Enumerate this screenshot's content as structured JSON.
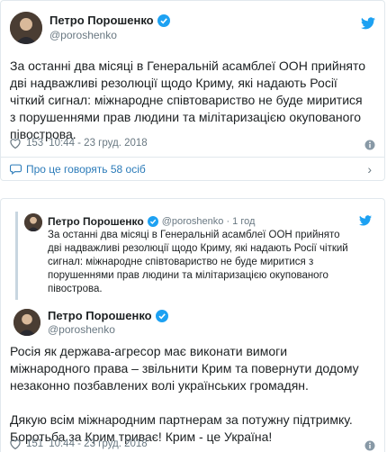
{
  "tweet1": {
    "author_name": "Петро Порошенко",
    "author_handle": "@poroshenko",
    "text": "За останні два місяці в  Генеральній асамблеї ООН прийнято\nдві надважливі резолюції  щодо Криму, які надають Росії\nчіткий сигнал: міжнародне співтовариство не буде миритися\nз порушеннями прав людини  та мілітаризацією окупованого\nпівострова.",
    "likes": "153",
    "timestamp": "10:44 - 23 груд. 2018",
    "talk_text": "Про це говорять 58 осіб"
  },
  "tweet2": {
    "quoted": {
      "author_name": "Петро Порошенко",
      "author_handle": "@poroshenko · 1 год",
      "text": "За останні два місяці в  Генеральній асамблеї ООН прийнято\nдві надважливі резолюції  щодо Криму, які надають Росії чіткий\nсигнал: міжнародне співтовариство не буде миритися з\nпорушеннями прав людини  та мілітаризацією окупованого\nпівострова."
    },
    "author_name": "Петро Порошенко",
    "author_handle": "@poroshenko",
    "text": "Росія як держава-агресор має виконати вимоги\nміжнародного права – звільнити Крим та повернути додому\nнезаконно позбавлених волі українських громадян.\n\nДякую всім міжнародним партнерам за потужну підтримку.\nБоротьба за Крим триває! Крим - це Україна!",
    "likes": "151",
    "timestamp": "10:44 - 23 груд. 2018"
  },
  "icons": {
    "verified": "verified-badge-icon",
    "bird": "twitter-bird-icon",
    "heart": "heart-icon",
    "info": "info-icon",
    "comment": "comment-bubble-icon",
    "chevron": "chevron-right-icon"
  },
  "colors": {
    "accent": "#1da1f2",
    "link": "#2b7bb9",
    "muted": "#697882",
    "border": "#e1e8ed"
  }
}
